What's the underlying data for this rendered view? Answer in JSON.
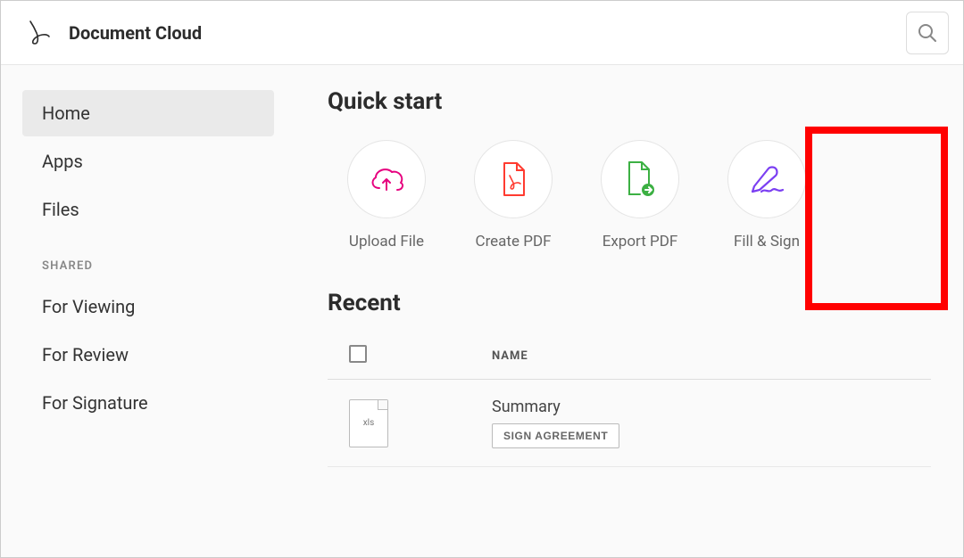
{
  "header": {
    "title": "Document Cloud"
  },
  "sidebar": {
    "primary": [
      {
        "label": "Home",
        "active": true
      },
      {
        "label": "Apps",
        "active": false
      },
      {
        "label": "Files",
        "active": false
      }
    ],
    "shared_label": "SHARED",
    "shared": [
      {
        "label": "For Viewing"
      },
      {
        "label": "For Review"
      },
      {
        "label": "For Signature"
      }
    ]
  },
  "main": {
    "quick_start": {
      "title": "Quick start",
      "items": [
        {
          "label": "Upload File",
          "icon": "cloud-upload-icon",
          "color": "#e6007e"
        },
        {
          "label": "Create PDF",
          "icon": "pdf-file-icon",
          "color": "#ff3b30"
        },
        {
          "label": "Export PDF",
          "icon": "export-file-icon",
          "color": "#3cb043"
        },
        {
          "label": "Fill & Sign",
          "icon": "sign-pen-icon",
          "color": "#7b3ff2"
        }
      ]
    },
    "recent": {
      "title": "Recent",
      "columns": {
        "name": "NAME"
      },
      "rows": [
        {
          "filename": "Summary",
          "filetype_badge": "xls",
          "action_label": "SIGN AGREEMENT"
        }
      ]
    }
  },
  "annotations": {
    "highlighted_quickstart_index": 3
  }
}
